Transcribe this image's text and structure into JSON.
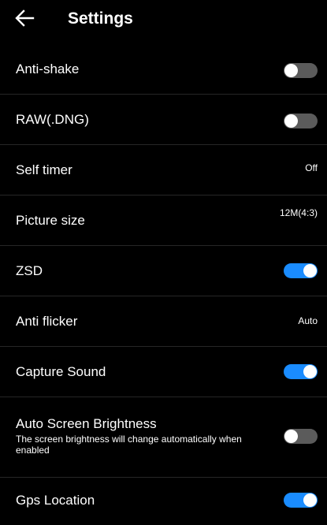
{
  "header": {
    "title": "Settings",
    "back_icon": "arrow-left-icon"
  },
  "colors": {
    "background": "#000000",
    "toggle_on": "#1a8cff",
    "toggle_off": "#5b5b5b",
    "divider": "#262626"
  },
  "settings": [
    {
      "label": "Anti-shake",
      "control": "toggle",
      "on": false
    },
    {
      "label": "RAW(.DNG)",
      "control": "toggle",
      "on": false
    },
    {
      "label": "Self timer",
      "control": "value",
      "value": "Off"
    },
    {
      "label": "Picture size",
      "control": "value",
      "value": "12M(4:3)"
    },
    {
      "label": "ZSD",
      "control": "toggle",
      "on": true
    },
    {
      "label": "Anti flicker",
      "control": "value",
      "value": "Auto"
    },
    {
      "label": "Capture Sound",
      "control": "toggle",
      "on": true
    },
    {
      "label": "Auto Screen Brightness",
      "description": "The screen brightness will change automatically when enabled",
      "control": "toggle",
      "on": false
    },
    {
      "label": "Gps Location",
      "control": "toggle",
      "on": true
    }
  ]
}
